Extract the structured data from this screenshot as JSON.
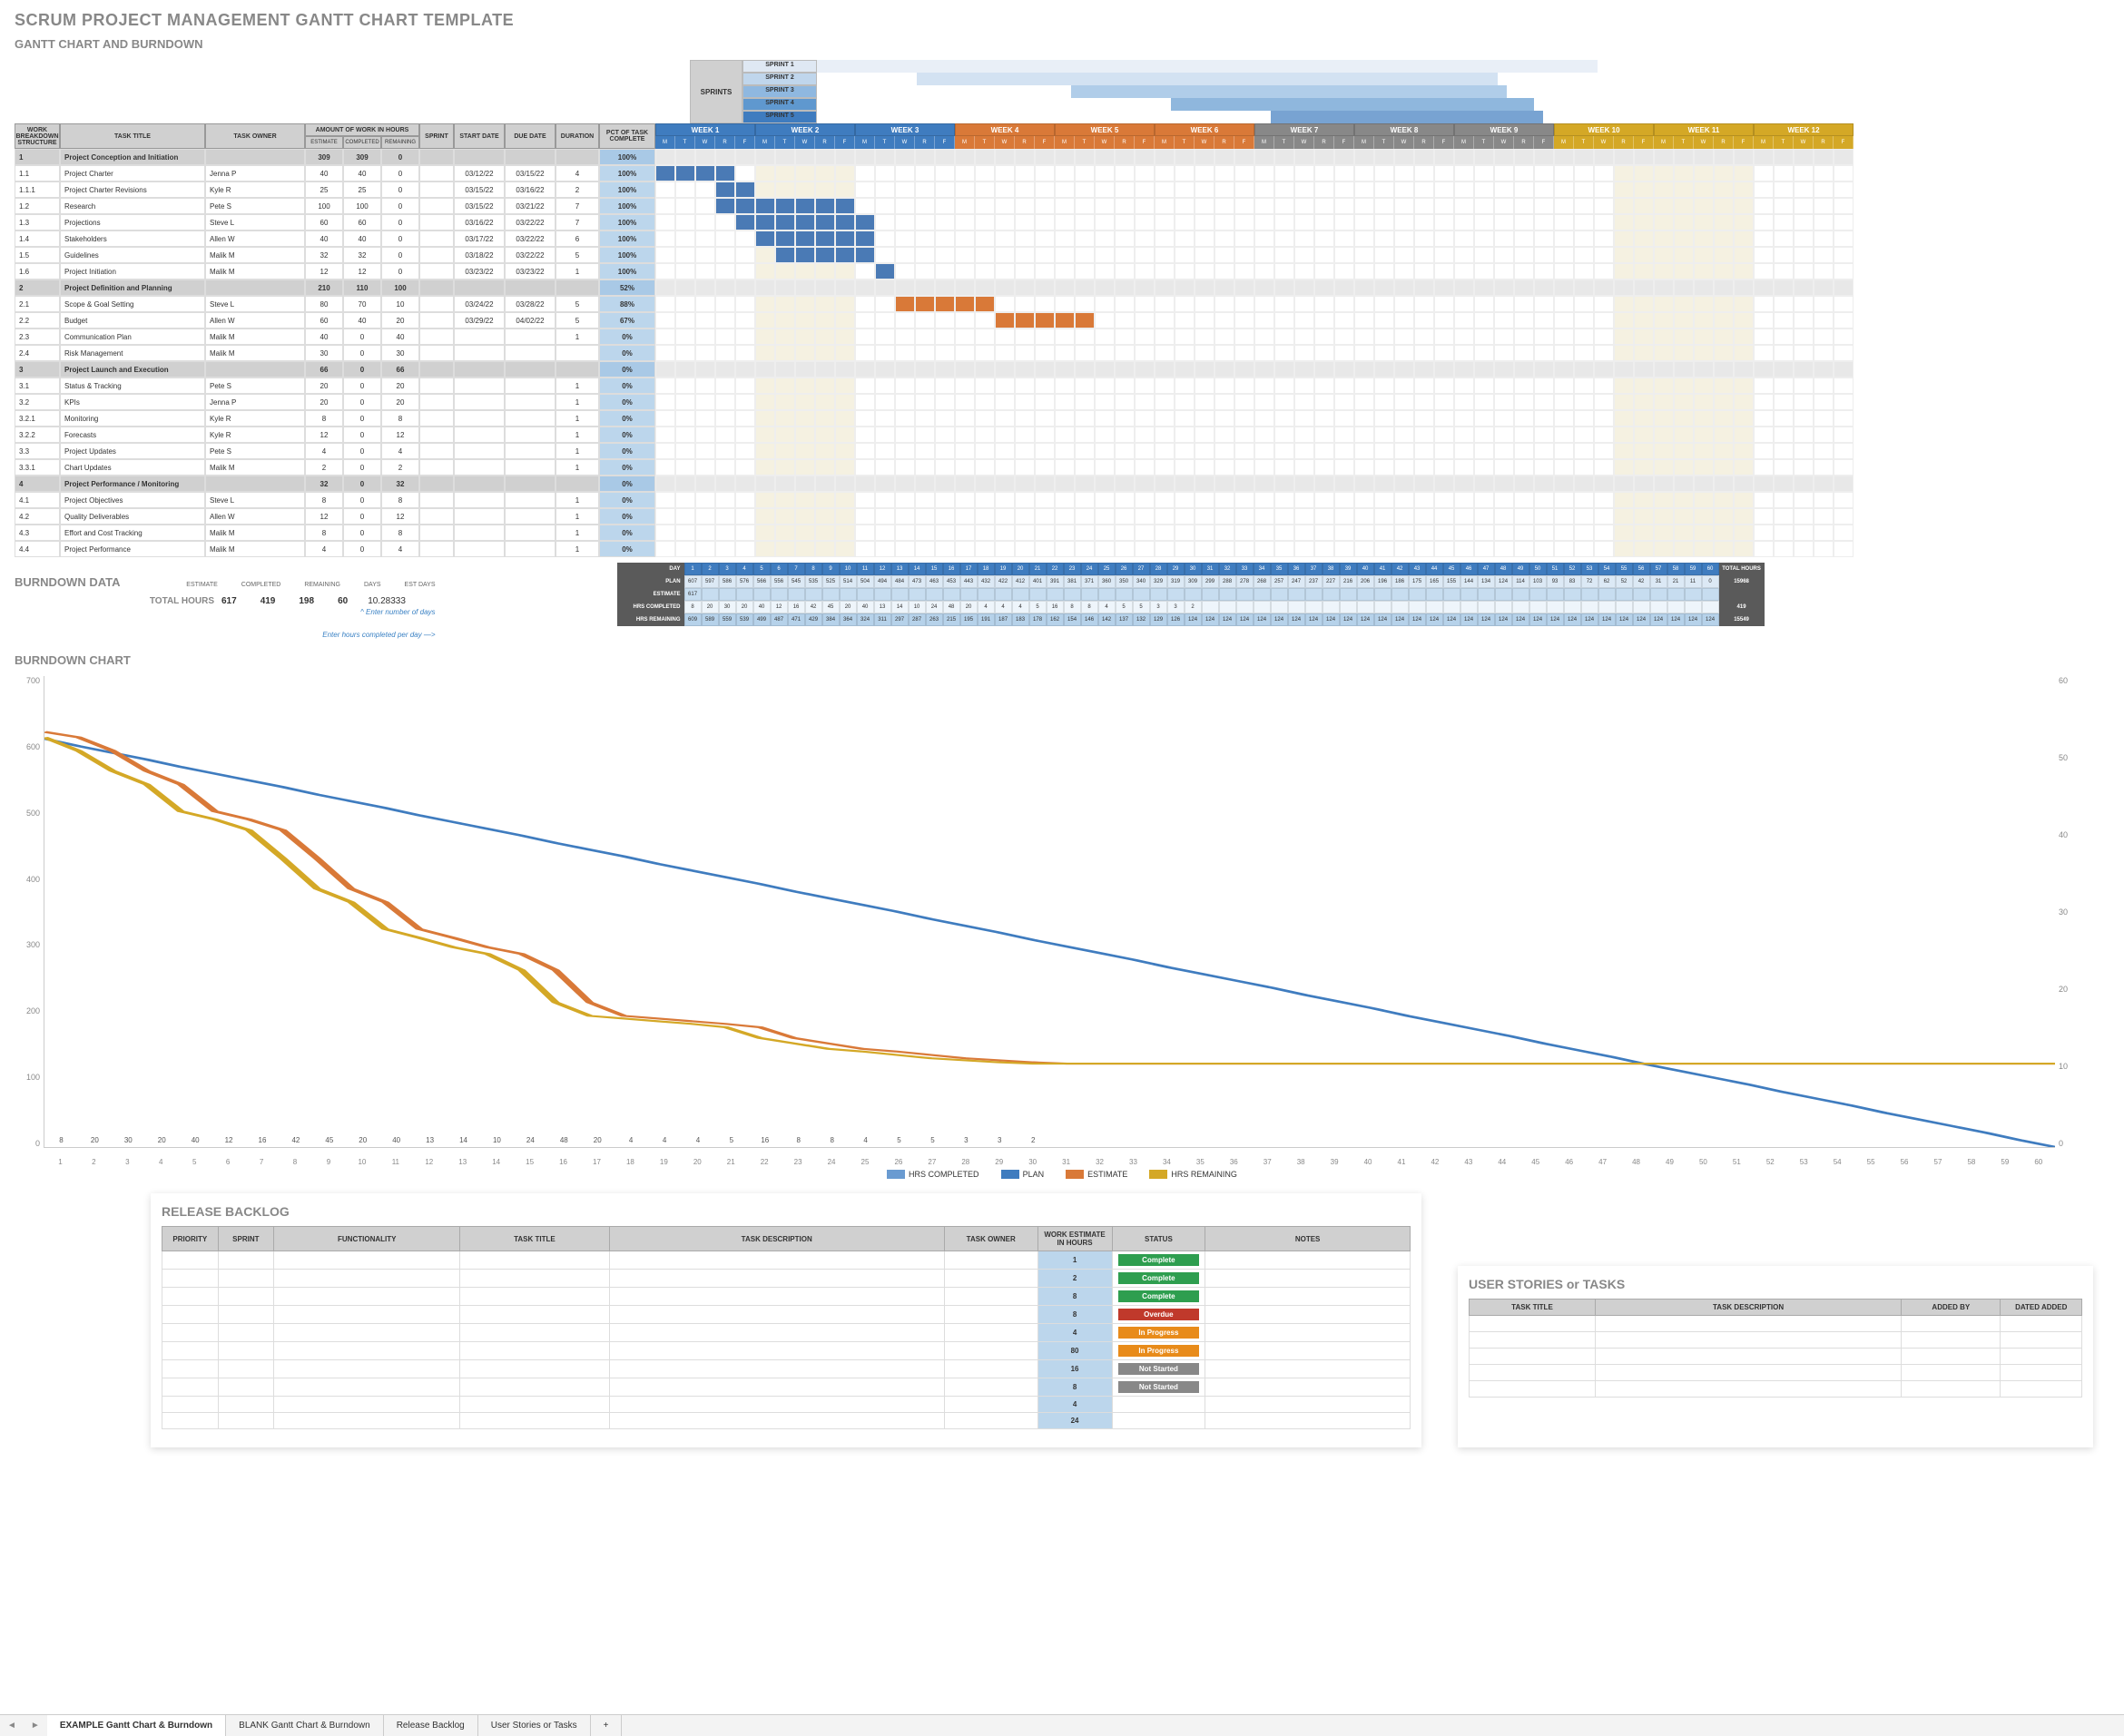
{
  "titles": {
    "main": "SCRUM PROJECT MANAGEMENT GANTT CHART TEMPLATE",
    "sub": "GANTT CHART AND BURNDOWN",
    "bd_data": "BURNDOWN DATA",
    "bd_chart": "BURNDOWN CHART",
    "backlog": "RELEASE BACKLOG",
    "stories": "USER STORIES or TASKS"
  },
  "sprints_label": "SPRINTS",
  "sprints": [
    {
      "name": "SPRINT 1",
      "color": "#dfe8f3"
    },
    {
      "name": "SPRINT 2",
      "color": "#c0d6ec"
    },
    {
      "name": "SPRINT 3",
      "color": "#8fb8e0"
    },
    {
      "name": "SPRINT 4",
      "color": "#5f98cf"
    },
    {
      "name": "SPRINT 5",
      "color": "#3f7cbf"
    }
  ],
  "gantt_headers": {
    "wbs": "WORK BREAKDOWN STRUCTURE",
    "title": "TASK TITLE",
    "owner": "TASK OWNER",
    "work": "AMOUNT OF WORK IN HOURS",
    "est": "ESTIMATE",
    "comp": "COMPLETED",
    "rem": "REMAINING",
    "sprint": "SPRINT",
    "start": "START DATE",
    "due": "DUE DATE",
    "dur": "DURATION",
    "pct": "PCT OF TASK COMPLETE"
  },
  "weeks": [
    {
      "label": "WEEK 1",
      "color": "#3f7cbf"
    },
    {
      "label": "WEEK 2",
      "color": "#3f7cbf"
    },
    {
      "label": "WEEK 3",
      "color": "#3f7cbf"
    },
    {
      "label": "WEEK 4",
      "color": "#d97938"
    },
    {
      "label": "WEEK 5",
      "color": "#d97938"
    },
    {
      "label": "WEEK 6",
      "color": "#d97938"
    },
    {
      "label": "WEEK 7",
      "color": "#888"
    },
    {
      "label": "WEEK 8",
      "color": "#888"
    },
    {
      "label": "WEEK 9",
      "color": "#888"
    },
    {
      "label": "WEEK 10",
      "color": "#d4a826"
    },
    {
      "label": "WEEK 11",
      "color": "#d4a826"
    },
    {
      "label": "WEEK 12",
      "color": "#d4a826"
    }
  ],
  "day_letters": [
    "M",
    "T",
    "W",
    "R",
    "F"
  ],
  "tasks": [
    {
      "wbs": "1",
      "title": "Project Conception and Initiation",
      "owner": "",
      "est": 309,
      "comp": 309,
      "rem": 0,
      "sprint": "",
      "start": "",
      "due": "",
      "dur": "",
      "pct": "100%",
      "phase": true
    },
    {
      "wbs": "1.1",
      "title": "Project Charter",
      "owner": "Jenna P",
      "est": 40,
      "comp": 40,
      "rem": 0,
      "sprint": "",
      "start": "03/12/22",
      "due": "03/15/22",
      "dur": 4,
      "pct": "100%",
      "bar": [
        0,
        4,
        "bar1"
      ]
    },
    {
      "wbs": "1.1.1",
      "title": "Project Charter Revisions",
      "owner": "Kyle R",
      "est": 25,
      "comp": 25,
      "rem": 0,
      "sprint": "",
      "start": "03/15/22",
      "due": "03/16/22",
      "dur": 2,
      "pct": "100%",
      "bar": [
        3,
        2,
        "bar1"
      ]
    },
    {
      "wbs": "1.2",
      "title": "Research",
      "owner": "Pete S",
      "est": 100,
      "comp": 100,
      "rem": 0,
      "sprint": "",
      "start": "03/15/22",
      "due": "03/21/22",
      "dur": 7,
      "pct": "100%",
      "bar": [
        3,
        7,
        "bar1"
      ]
    },
    {
      "wbs": "1.3",
      "title": "Projections",
      "owner": "Steve L",
      "est": 60,
      "comp": 60,
      "rem": 0,
      "sprint": "",
      "start": "03/16/22",
      "due": "03/22/22",
      "dur": 7,
      "pct": "100%",
      "bar": [
        4,
        7,
        "bar1"
      ]
    },
    {
      "wbs": "1.4",
      "title": "Stakeholders",
      "owner": "Allen W",
      "est": 40,
      "comp": 40,
      "rem": 0,
      "sprint": "",
      "start": "03/17/22",
      "due": "03/22/22",
      "dur": 6,
      "pct": "100%",
      "bar": [
        5,
        6,
        "bar1"
      ]
    },
    {
      "wbs": "1.5",
      "title": "Guidelines",
      "owner": "Malik M",
      "est": 32,
      "comp": 32,
      "rem": 0,
      "sprint": "",
      "start": "03/18/22",
      "due": "03/22/22",
      "dur": 5,
      "pct": "100%",
      "bar": [
        6,
        5,
        "bar1"
      ]
    },
    {
      "wbs": "1.6",
      "title": "Project Initiation",
      "owner": "Malik M",
      "est": 12,
      "comp": 12,
      "rem": 0,
      "sprint": "",
      "start": "03/23/22",
      "due": "03/23/22",
      "dur": 1,
      "pct": "100%",
      "bar": [
        11,
        1,
        "bar1"
      ]
    },
    {
      "wbs": "2",
      "title": "Project Definition and Planning",
      "owner": "",
      "est": 210,
      "comp": 110,
      "rem": 100,
      "sprint": "",
      "start": "",
      "due": "",
      "dur": "",
      "pct": "52%",
      "phase": true
    },
    {
      "wbs": "2.1",
      "title": "Scope & Goal Setting",
      "owner": "Steve L",
      "est": 80,
      "comp": 70,
      "rem": 10,
      "sprint": "",
      "start": "03/24/22",
      "due": "03/28/22",
      "dur": 5,
      "pct": "88%",
      "bar": [
        12,
        5,
        "bar3"
      ]
    },
    {
      "wbs": "2.2",
      "title": "Budget",
      "owner": "Allen W",
      "est": 60,
      "comp": 40,
      "rem": 20,
      "sprint": "",
      "start": "03/29/22",
      "due": "04/02/22",
      "dur": 5,
      "pct": "67%",
      "bar": [
        17,
        5,
        "bar3"
      ]
    },
    {
      "wbs": "2.3",
      "title": "Communication Plan",
      "owner": "Malik M",
      "est": 40,
      "comp": 0,
      "rem": 40,
      "sprint": "",
      "start": "",
      "due": "",
      "dur": 1,
      "pct": "0%"
    },
    {
      "wbs": "2.4",
      "title": "Risk Management",
      "owner": "Malik M",
      "est": 30,
      "comp": 0,
      "rem": 30,
      "sprint": "",
      "start": "",
      "due": "",
      "dur": "",
      "pct": "0%"
    },
    {
      "wbs": "3",
      "title": "Project Launch and Execution",
      "owner": "",
      "est": 66,
      "comp": 0,
      "rem": 66,
      "sprint": "",
      "start": "",
      "due": "",
      "dur": "",
      "pct": "0%",
      "phase": true
    },
    {
      "wbs": "3.1",
      "title": "Status & Tracking",
      "owner": "Pete S",
      "est": 20,
      "comp": 0,
      "rem": 20,
      "sprint": "",
      "start": "",
      "due": "",
      "dur": 1,
      "pct": "0%"
    },
    {
      "wbs": "3.2",
      "title": "KPIs",
      "owner": "Jenna P",
      "est": 20,
      "comp": 0,
      "rem": 20,
      "sprint": "",
      "start": "",
      "due": "",
      "dur": 1,
      "pct": "0%"
    },
    {
      "wbs": "3.2.1",
      "title": "Monitoring",
      "owner": "Kyle R",
      "est": 8,
      "comp": 0,
      "rem": 8,
      "sprint": "",
      "start": "",
      "due": "",
      "dur": 1,
      "pct": "0%"
    },
    {
      "wbs": "3.2.2",
      "title": "Forecasts",
      "owner": "Kyle R",
      "est": 12,
      "comp": 0,
      "rem": 12,
      "sprint": "",
      "start": "",
      "due": "",
      "dur": 1,
      "pct": "0%"
    },
    {
      "wbs": "3.3",
      "title": "Project Updates",
      "owner": "Pete S",
      "est": 4,
      "comp": 0,
      "rem": 4,
      "sprint": "",
      "start": "",
      "due": "",
      "dur": 1,
      "pct": "0%"
    },
    {
      "wbs": "3.3.1",
      "title": "Chart Updates",
      "owner": "Malik M",
      "est": 2,
      "comp": 0,
      "rem": 2,
      "sprint": "",
      "start": "",
      "due": "",
      "dur": 1,
      "pct": "0%"
    },
    {
      "wbs": "4",
      "title": "Project Performance / Monitoring",
      "owner": "",
      "est": 32,
      "comp": 0,
      "rem": 32,
      "sprint": "",
      "start": "",
      "due": "",
      "dur": "",
      "pct": "0%",
      "phase": true
    },
    {
      "wbs": "4.1",
      "title": "Project Objectives",
      "owner": "Steve L",
      "est": 8,
      "comp": 0,
      "rem": 8,
      "sprint": "",
      "start": "",
      "due": "",
      "dur": 1,
      "pct": "0%"
    },
    {
      "wbs": "4.2",
      "title": "Quality Deliverables",
      "owner": "Allen W",
      "est": 12,
      "comp": 0,
      "rem": 12,
      "sprint": "",
      "start": "",
      "due": "",
      "dur": 1,
      "pct": "0%"
    },
    {
      "wbs": "4.3",
      "title": "Effort and Cost Tracking",
      "owner": "Malik M",
      "est": 8,
      "comp": 0,
      "rem": 8,
      "sprint": "",
      "start": "",
      "due": "",
      "dur": 1,
      "pct": "0%"
    },
    {
      "wbs": "4.4",
      "title": "Project Performance",
      "owner": "Malik M",
      "est": 4,
      "comp": 0,
      "rem": 4,
      "sprint": "",
      "start": "",
      "due": "",
      "dur": 1,
      "pct": "0%"
    }
  ],
  "totals": {
    "label": "TOTAL HOURS",
    "est": 617,
    "comp": 419,
    "rem": 198,
    "days_lbl": "DAYS",
    "days": 60,
    "estdays_lbl": "EST DAYS",
    "estdays": "10.28333",
    "sub_est": "ESTIMATE",
    "sub_comp": "COMPLETED",
    "sub_rem": "REMAINING"
  },
  "hints": {
    "days": "^ Enter number of days",
    "perday": "Enter hours completed per day  —>"
  },
  "bd_headers": {
    "day": "DAY",
    "plan": "PLAN",
    "est": "ESTIMATE",
    "comp": "HRS COMPLETED",
    "rem": "HRS REMAINING",
    "total": "TOTAL HOURS"
  },
  "bd": {
    "days": 60,
    "plan_start": 607,
    "plan_step": -10.28,
    "est_start": 617,
    "completed": [
      8,
      20,
      30,
      20,
      40,
      12,
      16,
      42,
      45,
      20,
      40,
      13,
      14,
      10,
      24,
      48,
      20,
      4,
      4,
      4,
      5,
      16,
      8,
      8,
      4,
      5,
      5,
      3,
      3,
      2
    ],
    "totals": {
      "plan": 15968,
      "est": "",
      "comp": 419,
      "rem": 15549
    }
  },
  "chart_data": {
    "type": "combo",
    "x": [
      1,
      2,
      3,
      4,
      5,
      6,
      7,
      8,
      9,
      10,
      11,
      12,
      13,
      14,
      15,
      16,
      17,
      18,
      19,
      20,
      21,
      22,
      23,
      24,
      25,
      26,
      27,
      28,
      29,
      30,
      31,
      32,
      33,
      34,
      35,
      36,
      37,
      38,
      39,
      40,
      41,
      42,
      43,
      44,
      45,
      46,
      47,
      48,
      49,
      50,
      51,
      52,
      53,
      54,
      55,
      56,
      57,
      58,
      59,
      60
    ],
    "bars": {
      "name": "HRS COMPLETED",
      "values": [
        8,
        20,
        30,
        20,
        40,
        12,
        16,
        42,
        45,
        20,
        40,
        13,
        14,
        10,
        24,
        48,
        20,
        4,
        4,
        4,
        5,
        16,
        8,
        8,
        4,
        5,
        5,
        3,
        3,
        2,
        0,
        0,
        0,
        0,
        0,
        0,
        0,
        0,
        0,
        0,
        0,
        0,
        0,
        0,
        0,
        0,
        0,
        0,
        0,
        0,
        0,
        0,
        0,
        0,
        0,
        0,
        0,
        0,
        0,
        0
      ],
      "axis": "right",
      "color": "#6a9bd1"
    },
    "series": [
      {
        "name": "PLAN",
        "color": "#3f7cbf",
        "axis": "left",
        "y": [
          607,
          596,
          586,
          576,
          565,
          555,
          545,
          535,
          524,
          514,
          504,
          493,
          483,
          473,
          463,
          452,
          442,
          432,
          421,
          411,
          401,
          391,
          380,
          370,
          360,
          350,
          339,
          329,
          319,
          308,
          298,
          288,
          278,
          267,
          257,
          247,
          237,
          226,
          216,
          206,
          195,
          185,
          175,
          165,
          154,
          144,
          134,
          123,
          113,
          103,
          93,
          82,
          72,
          62,
          51,
          41,
          31,
          21,
          10,
          0
        ]
      },
      {
        "name": "ESTIMATE",
        "color": "#d97938",
        "axis": "left",
        "y": [
          617,
          609,
          589,
          559,
          539,
          499,
          487,
          471,
          429,
          384,
          364,
          324,
          311,
          297,
          287,
          263,
          215,
          195,
          191,
          187,
          183,
          178,
          162,
          154,
          146,
          142,
          137,
          132,
          129,
          126,
          124,
          124,
          124,
          124,
          124,
          124,
          124,
          124,
          124,
          124,
          124,
          124,
          124,
          124,
          124,
          124,
          124,
          124,
          124,
          124,
          124,
          124,
          124,
          124,
          124,
          124,
          124,
          124,
          124,
          124
        ]
      },
      {
        "name": "HRS REMAINING",
        "color": "#d4a826",
        "axis": "left",
        "y": [
          609,
          589,
          559,
          539,
          499,
          487,
          471,
          429,
          384,
          364,
          324,
          311,
          297,
          287,
          263,
          215,
          195,
          191,
          187,
          183,
          178,
          162,
          154,
          146,
          142,
          137,
          132,
          129,
          126,
          124,
          124,
          124,
          124,
          124,
          124,
          124,
          124,
          124,
          124,
          124,
          124,
          124,
          124,
          124,
          124,
          124,
          124,
          124,
          124,
          124,
          124,
          124,
          124,
          124,
          124,
          124,
          124,
          124,
          124,
          124
        ]
      }
    ],
    "yleft": {
      "min": 0,
      "max": 700,
      "ticks": [
        0,
        100,
        200,
        300,
        400,
        500,
        600,
        700
      ]
    },
    "yright": {
      "min": 0,
      "max": 60,
      "ticks": [
        0,
        10,
        20,
        30,
        40,
        50,
        60
      ]
    },
    "legend": [
      "HRS COMPLETED",
      "PLAN",
      "ESTIMATE",
      "HRS REMAINING"
    ]
  },
  "backlog": {
    "headers": [
      "PRIORITY",
      "SPRINT",
      "FUNCTIONALITY",
      "TASK TITLE",
      "TASK DESCRIPTION",
      "TASK OWNER",
      "WORK ESTIMATE IN HOURS",
      "STATUS",
      "NOTES"
    ],
    "rows": [
      {
        "est": 1,
        "status": "Complete",
        "cls": "bg-g"
      },
      {
        "est": 2,
        "status": "Complete",
        "cls": "bg-g"
      },
      {
        "est": 8,
        "status": "Complete",
        "cls": "bg-g"
      },
      {
        "est": 8,
        "status": "Overdue",
        "cls": "bg-r"
      },
      {
        "est": 4,
        "status": "In Progress",
        "cls": "bg-o"
      },
      {
        "est": 80,
        "status": "In Progress",
        "cls": "bg-o"
      },
      {
        "est": 16,
        "status": "Not Started",
        "cls": "bg-gr"
      },
      {
        "est": 8,
        "status": "Not Started",
        "cls": "bg-gr"
      },
      {
        "est": 4,
        "status": "",
        "cls": ""
      },
      {
        "est": 24,
        "status": "",
        "cls": ""
      }
    ]
  },
  "stories": {
    "headers": [
      "TASK TITLE",
      "TASK DESCRIPTION",
      "ADDED BY",
      "DATED ADDED"
    ],
    "rows": 5
  },
  "tabs": [
    "EXAMPLE Gantt Chart & Burndown",
    "BLANK Gantt Chart & Burndown",
    "Release Backlog",
    "User Stories or Tasks"
  ]
}
